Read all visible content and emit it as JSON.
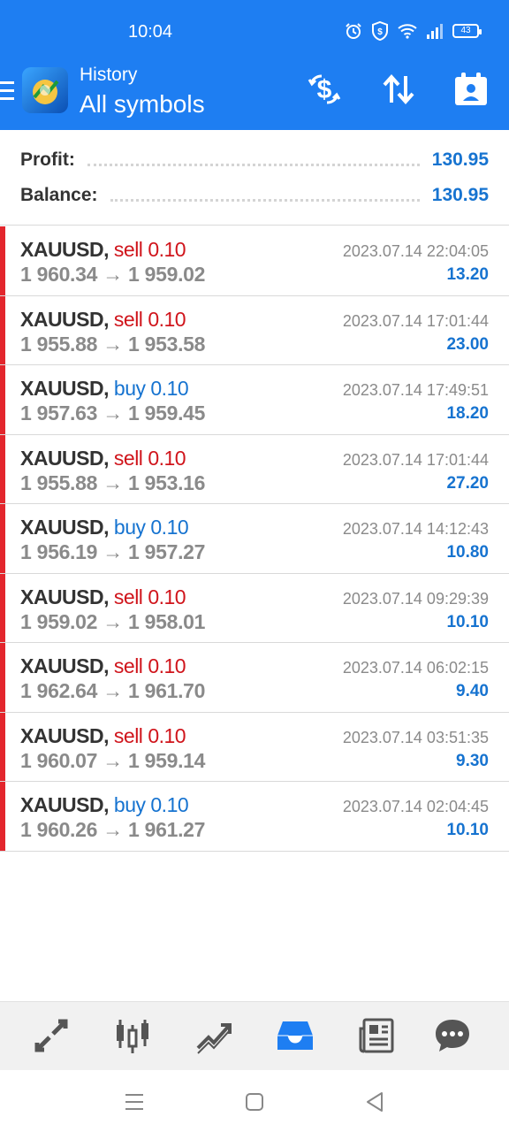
{
  "status_bar": {
    "time": "10:04",
    "battery": "43"
  },
  "header": {
    "title_small": "History",
    "title_big": "All symbols",
    "accent_color": "#1e7ef2",
    "icons": [
      "menu-icon",
      "app-logo",
      "currency-exchange-icon",
      "sort-icon",
      "calendar-icon"
    ]
  },
  "summary": {
    "profit_label": "Profit:",
    "profit_value": "130.95",
    "balance_label": "Balance:",
    "balance_value": "130.95"
  },
  "trades": [
    {
      "symbol": "XAUUSD,",
      "side": "sell",
      "volume": "0.10",
      "open": "1 960.34",
      "close": "1 959.02",
      "date": "2023.07.14 22:04:05",
      "profit": "13.20"
    },
    {
      "symbol": "XAUUSD,",
      "side": "sell",
      "volume": "0.10",
      "open": "1 955.88",
      "close": "1 953.58",
      "date": "2023.07.14 17:01:44",
      "profit": "23.00"
    },
    {
      "symbol": "XAUUSD,",
      "side": "buy",
      "volume": "0.10",
      "open": "1 957.63",
      "close": "1 959.45",
      "date": "2023.07.14 17:49:51",
      "profit": "18.20"
    },
    {
      "symbol": "XAUUSD,",
      "side": "sell",
      "volume": "0.10",
      "open": "1 955.88",
      "close": "1 953.16",
      "date": "2023.07.14 17:01:44",
      "profit": "27.20"
    },
    {
      "symbol": "XAUUSD,",
      "side": "buy",
      "volume": "0.10",
      "open": "1 956.19",
      "close": "1 957.27",
      "date": "2023.07.14 14:12:43",
      "profit": "10.80"
    },
    {
      "symbol": "XAUUSD,",
      "side": "sell",
      "volume": "0.10",
      "open": "1 959.02",
      "close": "1 958.01",
      "date": "2023.07.14 09:29:39",
      "profit": "10.10"
    },
    {
      "symbol": "XAUUSD,",
      "side": "sell",
      "volume": "0.10",
      "open": "1 962.64",
      "close": "1 961.70",
      "date": "2023.07.14 06:02:15",
      "profit": "9.40"
    },
    {
      "symbol": "XAUUSD,",
      "side": "sell",
      "volume": "0.10",
      "open": "1 960.07",
      "close": "1 959.14",
      "date": "2023.07.14 03:51:35",
      "profit": "9.30"
    },
    {
      "symbol": "XAUUSD,",
      "side": "buy",
      "volume": "0.10",
      "open": "1 960.26",
      "close": "1 961.27",
      "date": "2023.07.14 02:04:45",
      "profit": "10.10"
    }
  ],
  "colors": {
    "sell": "#d0141b",
    "buy": "#1673d0",
    "profit": "#1673d0",
    "row_bar": "#e3262d"
  },
  "bottom_nav": {
    "items": [
      "quotes-icon",
      "chart-icon",
      "trade-icon",
      "history-icon",
      "news-icon",
      "chat-icon"
    ],
    "active": "history-icon"
  },
  "system_nav": [
    "recent-apps-icon",
    "home-icon",
    "back-icon"
  ]
}
